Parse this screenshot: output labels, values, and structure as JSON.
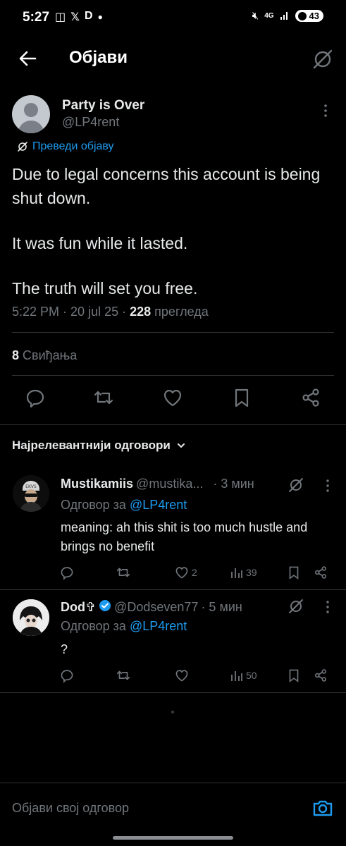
{
  "status": {
    "time": "5:27",
    "icons_left": [
      "screen-record-icon",
      "x-logo-icon",
      "d-app-icon",
      "dot"
    ],
    "network": "4G",
    "battery": "43"
  },
  "header": {
    "title": "Објави"
  },
  "tweet": {
    "author_name": "Party is Over",
    "author_handle": "@LP4rent",
    "translate_label": "Преведи објаву",
    "text_p1": "Due to legal concerns this account is being shut down.",
    "text_p2": "It was fun while it lasted.",
    "text_p3": "The truth will set you free.",
    "time": "5:22 PM",
    "date": "20 jul 25",
    "views_count": "228",
    "views_label": "прегледа",
    "likes_count": "8",
    "likes_label": "Свиђања"
  },
  "replies_sort": {
    "label": "Најрелевантнији одговори"
  },
  "replies": [
    {
      "name": "Mustikamiis",
      "handle": "@mustika...",
      "time": "· 3 мин",
      "reply_to_label": "Одговор за",
      "reply_to_handle": "@LP4rent",
      "text": "meaning: ah this shit is too much hustle and brings no benefit",
      "likes": "2",
      "views": "39"
    },
    {
      "name": "Dod✞",
      "handle": "@Dodseven77",
      "time": "· 5 мин",
      "reply_to_label": "Одговор за",
      "reply_to_handle": "@LP4rent",
      "text": "?",
      "likes": "",
      "views": "50"
    }
  ],
  "composer": {
    "placeholder": "Објави свој одговор"
  },
  "colors": {
    "background": "#000000",
    "text": "#e7e9ea",
    "secondary": "#71767b",
    "accent": "#1d9bf0",
    "divider": "#2f3336"
  }
}
